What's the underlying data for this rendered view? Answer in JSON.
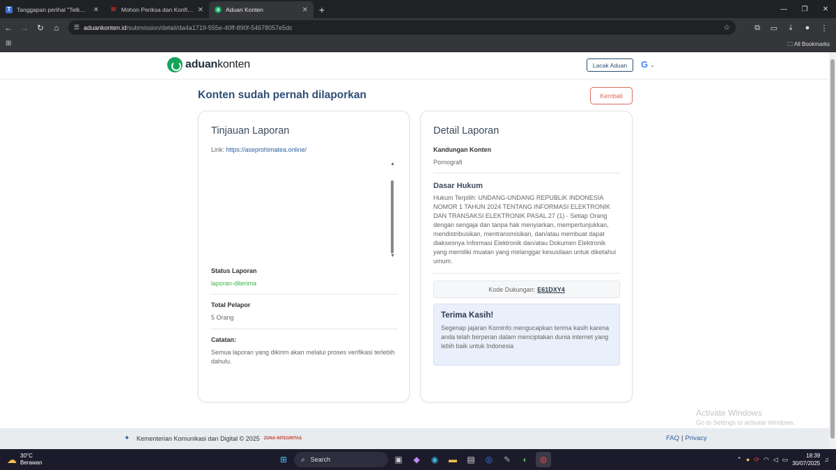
{
  "browser": {
    "tabs": [
      {
        "title": "Tanggapan perihal \"Telkomsel T",
        "favicon": "T",
        "favicon_color": "#3b6fd1",
        "active": false
      },
      {
        "title": "Mohon Periksa dan Konfirmasi",
        "favicon": "M",
        "favicon_color": "#d93025",
        "active": false
      },
      {
        "title": "Aduan Konten",
        "favicon": "a",
        "favicon_color": "#15a35a",
        "active": true
      }
    ],
    "url_host": "aduankonten.id",
    "url_path": "/submission/detail/da4a1719-555e-40ff-890f-54678057e5dc",
    "all_bookmarks": "All Bookmarks"
  },
  "site": {
    "logo_bold": "aduan",
    "logo_rest": "konten",
    "lacak_label": "Lacak Aduan",
    "google_glyph": "G",
    "page_title": "Konten sudah pernah dilaporkan",
    "kembali_label": "Kembali"
  },
  "tinjauan": {
    "title": "Tinjauan Laporan",
    "link_label": "Link: ",
    "link_url": "https://aseprohimatea.online/",
    "status_label": "Status Laporan",
    "status_value": "laporan-diterima",
    "total_label": "Total Pelapor",
    "total_value": "5 Orang",
    "catatan_label": "Catatan:",
    "catatan_value": "Semua laporan yang dikirim akan melalui proses verifikasi terlebih dahulu."
  },
  "detail": {
    "title": "Detail Laporan",
    "kandungan_label": "Kandungan Konten",
    "kandungan_value": "Pornografi",
    "dasar_label": "Dasar Hukum",
    "dasar_value": "Hukum Terpilih: UNDANG-UNDANG REPUBLIK INDONESIA NOMOR 1 TAHUN 2024 TENTANG INFORMASI ELEKTRONIK DAN TRANSAKSI ELEKTRONIK PASAL 27 (1) - Setiap Orang dengan sengaja dan tanpa hak menyiarkan, mempertunjukkan, mendistribusikan, mentransmisikan, dan/atau membuat dapat diaksesnya Informasi Elektronik dan/atau Dokumen Elektronik yang memiliki muatan yang melanggar kesusilaan untuk diketahui umum.",
    "kode_label": "Kode Dukungan:",
    "kode_value": "E61DXY4",
    "thanks_title": "Terima Kasih!",
    "thanks_text": "Segenap jajaran Kominfo mengucapkan terima kasih karena anda telah berperan dalam menciptakan dunia internet yang lebih baik untuk Indonesia"
  },
  "footer": {
    "copyright": "Kementerian Komunikasi dan Digital © 2025",
    "zi_logo_text": "ZONA INTEGRITAS",
    "faq": "FAQ",
    "separator": "|",
    "privacy": "Privacy"
  },
  "watermark": {
    "line1": "Activate Windows",
    "line2": "Go to Settings to activate Windows."
  },
  "taskbar": {
    "temperature": "30°C",
    "weather": "Berawan",
    "search": "Search",
    "time": "18:39",
    "date": "30/07/2025"
  }
}
